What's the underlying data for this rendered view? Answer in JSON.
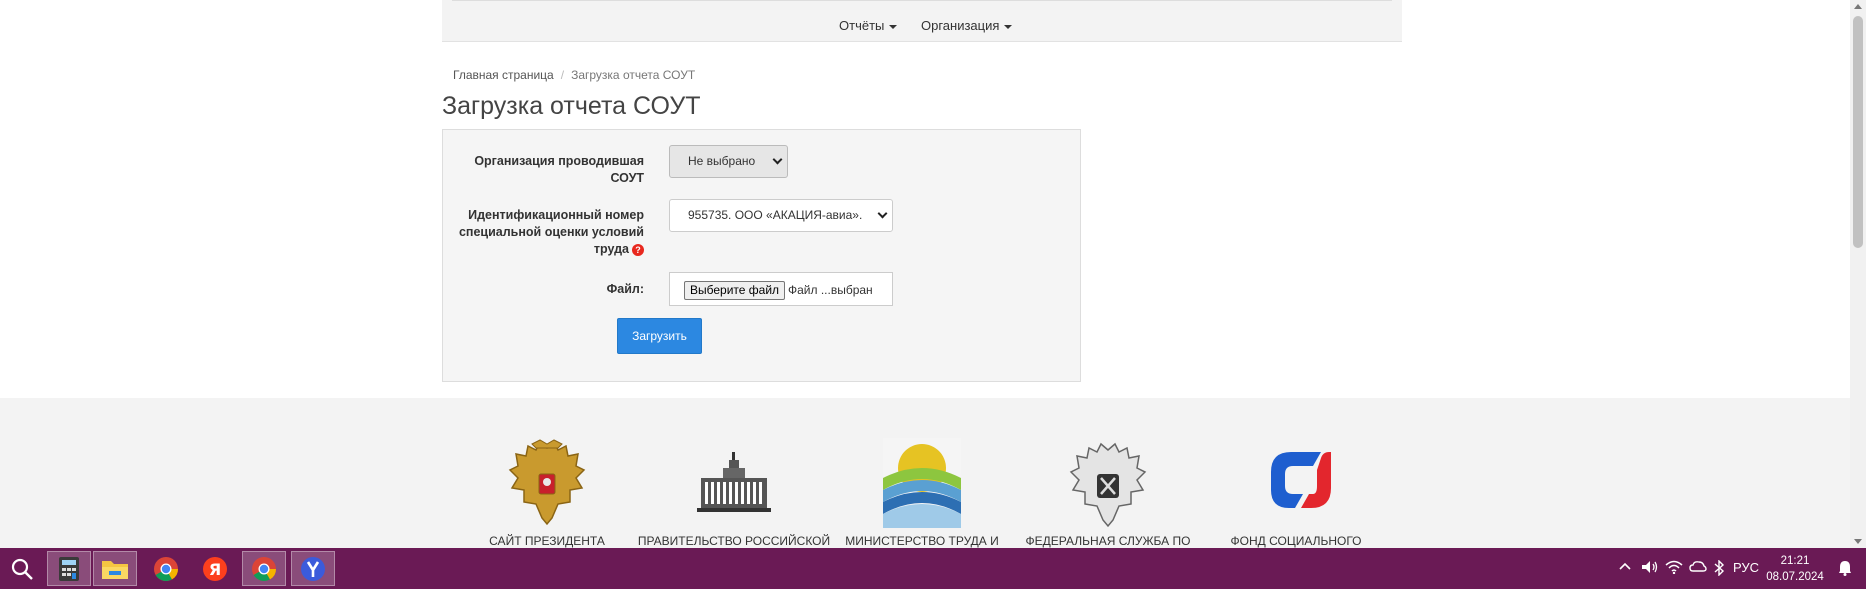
{
  "navbar": {
    "items": [
      {
        "label": "Отчёты"
      },
      {
        "label": "Организация"
      }
    ]
  },
  "breadcrumb": {
    "home": "Главная страница",
    "current": "Загрузка отчета СОУТ"
  },
  "page_title": "Загрузка отчета СОУТ",
  "form": {
    "org_label": "Организация проводившая СОУТ",
    "org_select_value": "Не выбрано",
    "id_label": "Идентификационный номер специальной оценки условий труда",
    "id_help_icon": "question-icon",
    "id_select_value": "955735. ООО «АКАЦИЯ-авиа».",
    "file_label": "Файл:",
    "file_button": "Выберите файл",
    "file_status": "Файл ...выбран",
    "submit_label": "Загрузить"
  },
  "footer": {
    "partners": [
      {
        "name": "САЙТ ПРЕЗИДЕНТА",
        "icon": "russian-coat-of-arms-icon"
      },
      {
        "name": "ПРАВИТЕЛЬСТВО РОССИЙСКОЙ",
        "icon": "government-building-icon"
      },
      {
        "name": "МИНИСТЕРСТВО ТРУДА И",
        "icon": "ministry-labor-logo-icon"
      },
      {
        "name": "ФЕДЕРАЛЬНАЯ СЛУЖБА ПО",
        "icon": "federal-service-emblem-icon"
      },
      {
        "name": "ФОНД СОЦИАЛЬНОГО",
        "icon": "social-fund-logo-icon"
      }
    ]
  },
  "taskbar": {
    "apps": [
      "search-icon",
      "calculator-icon",
      "file-explorer-icon",
      "chrome-icon",
      "yandex-icon",
      "chrome-icon",
      "yandex-browser-icon"
    ],
    "language": "РУС",
    "time": "21:21",
    "date": "08.07.2024",
    "color": "#6a1a55"
  },
  "colors": {
    "accent": "#2c88e1",
    "help_icon": "#e8281e"
  }
}
